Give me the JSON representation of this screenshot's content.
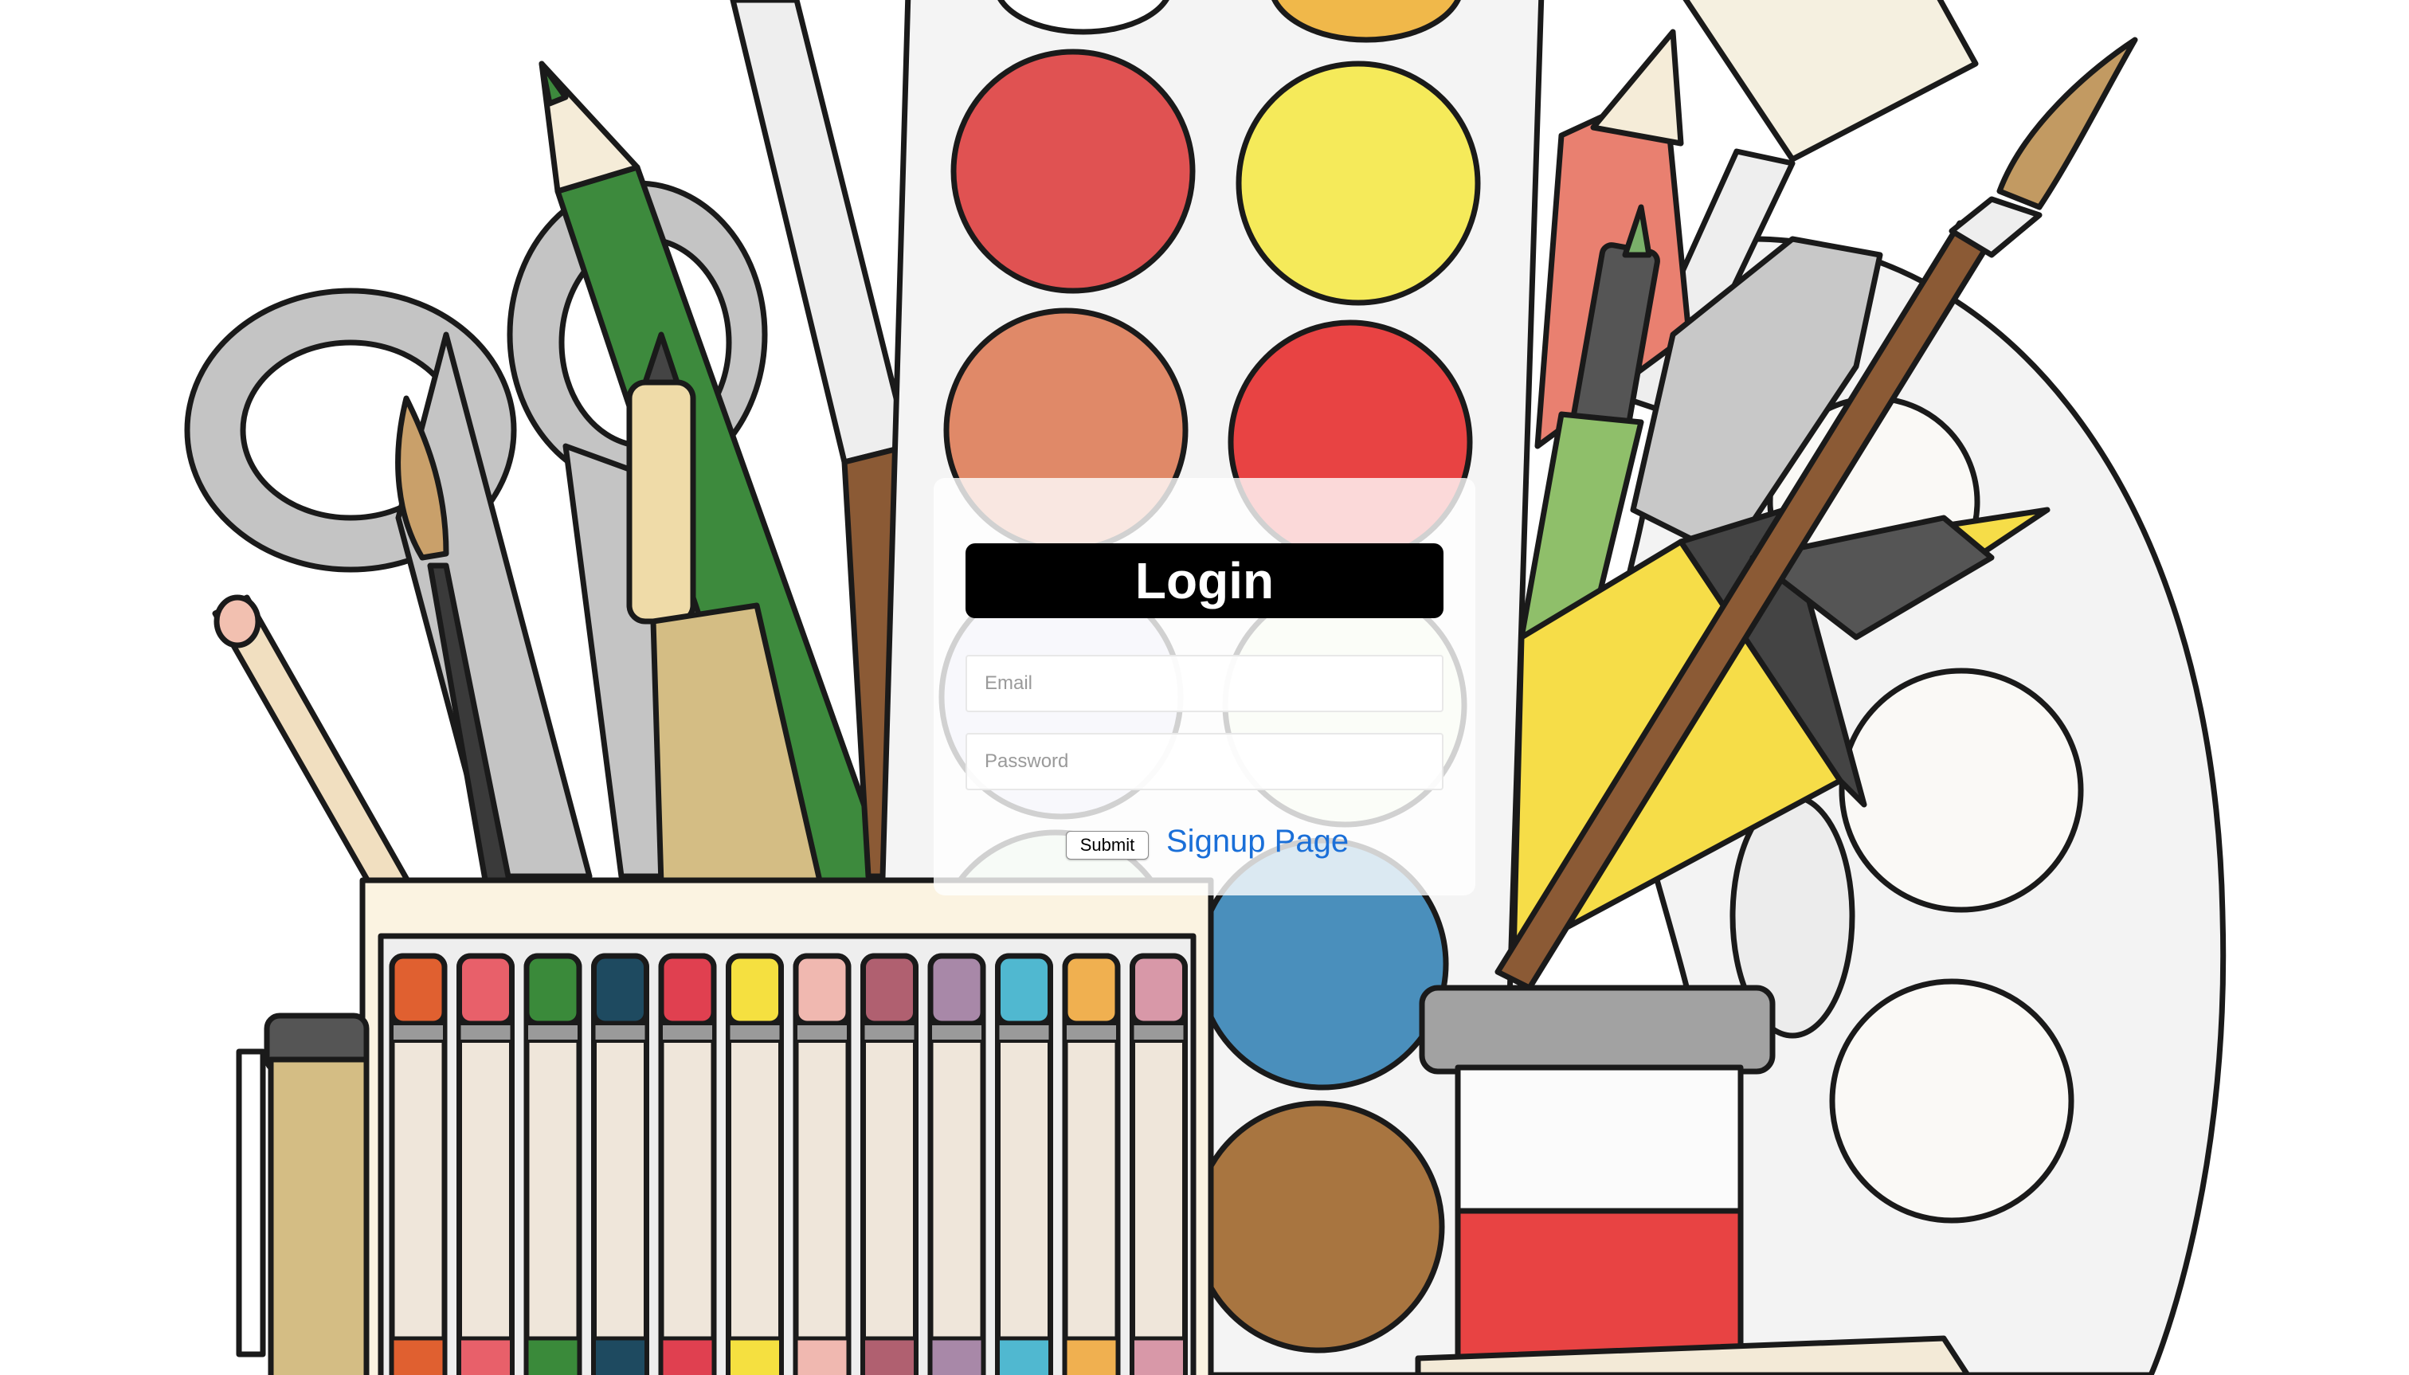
{
  "login": {
    "title": "Login",
    "email_placeholder": "Email",
    "password_placeholder": "Password",
    "submit_label": "Submit",
    "signup_link": "Signup Page"
  },
  "colors": {
    "title_bg": "#000000",
    "title_text": "#ffffff",
    "link": "#1a6fd8",
    "card": "rgba(255,255,255,0.80)"
  },
  "background": {
    "illustration": "art-supplies-illustration",
    "palette_colors": [
      "#e05252",
      "#f5ea5a",
      "#e08968",
      "#e84343",
      "#4a8fbc",
      "#a87540",
      "#dcdcf0",
      "#e8f4dc"
    ],
    "crayon_colors": [
      "#e06030",
      "#e8606a",
      "#3a8a3a",
      "#1e4a60",
      "#e04050",
      "#f5e040",
      "#f0b8b0",
      "#b06070",
      "#a888a8",
      "#50b8d0",
      "#f0b050",
      "#d898a8"
    ]
  }
}
